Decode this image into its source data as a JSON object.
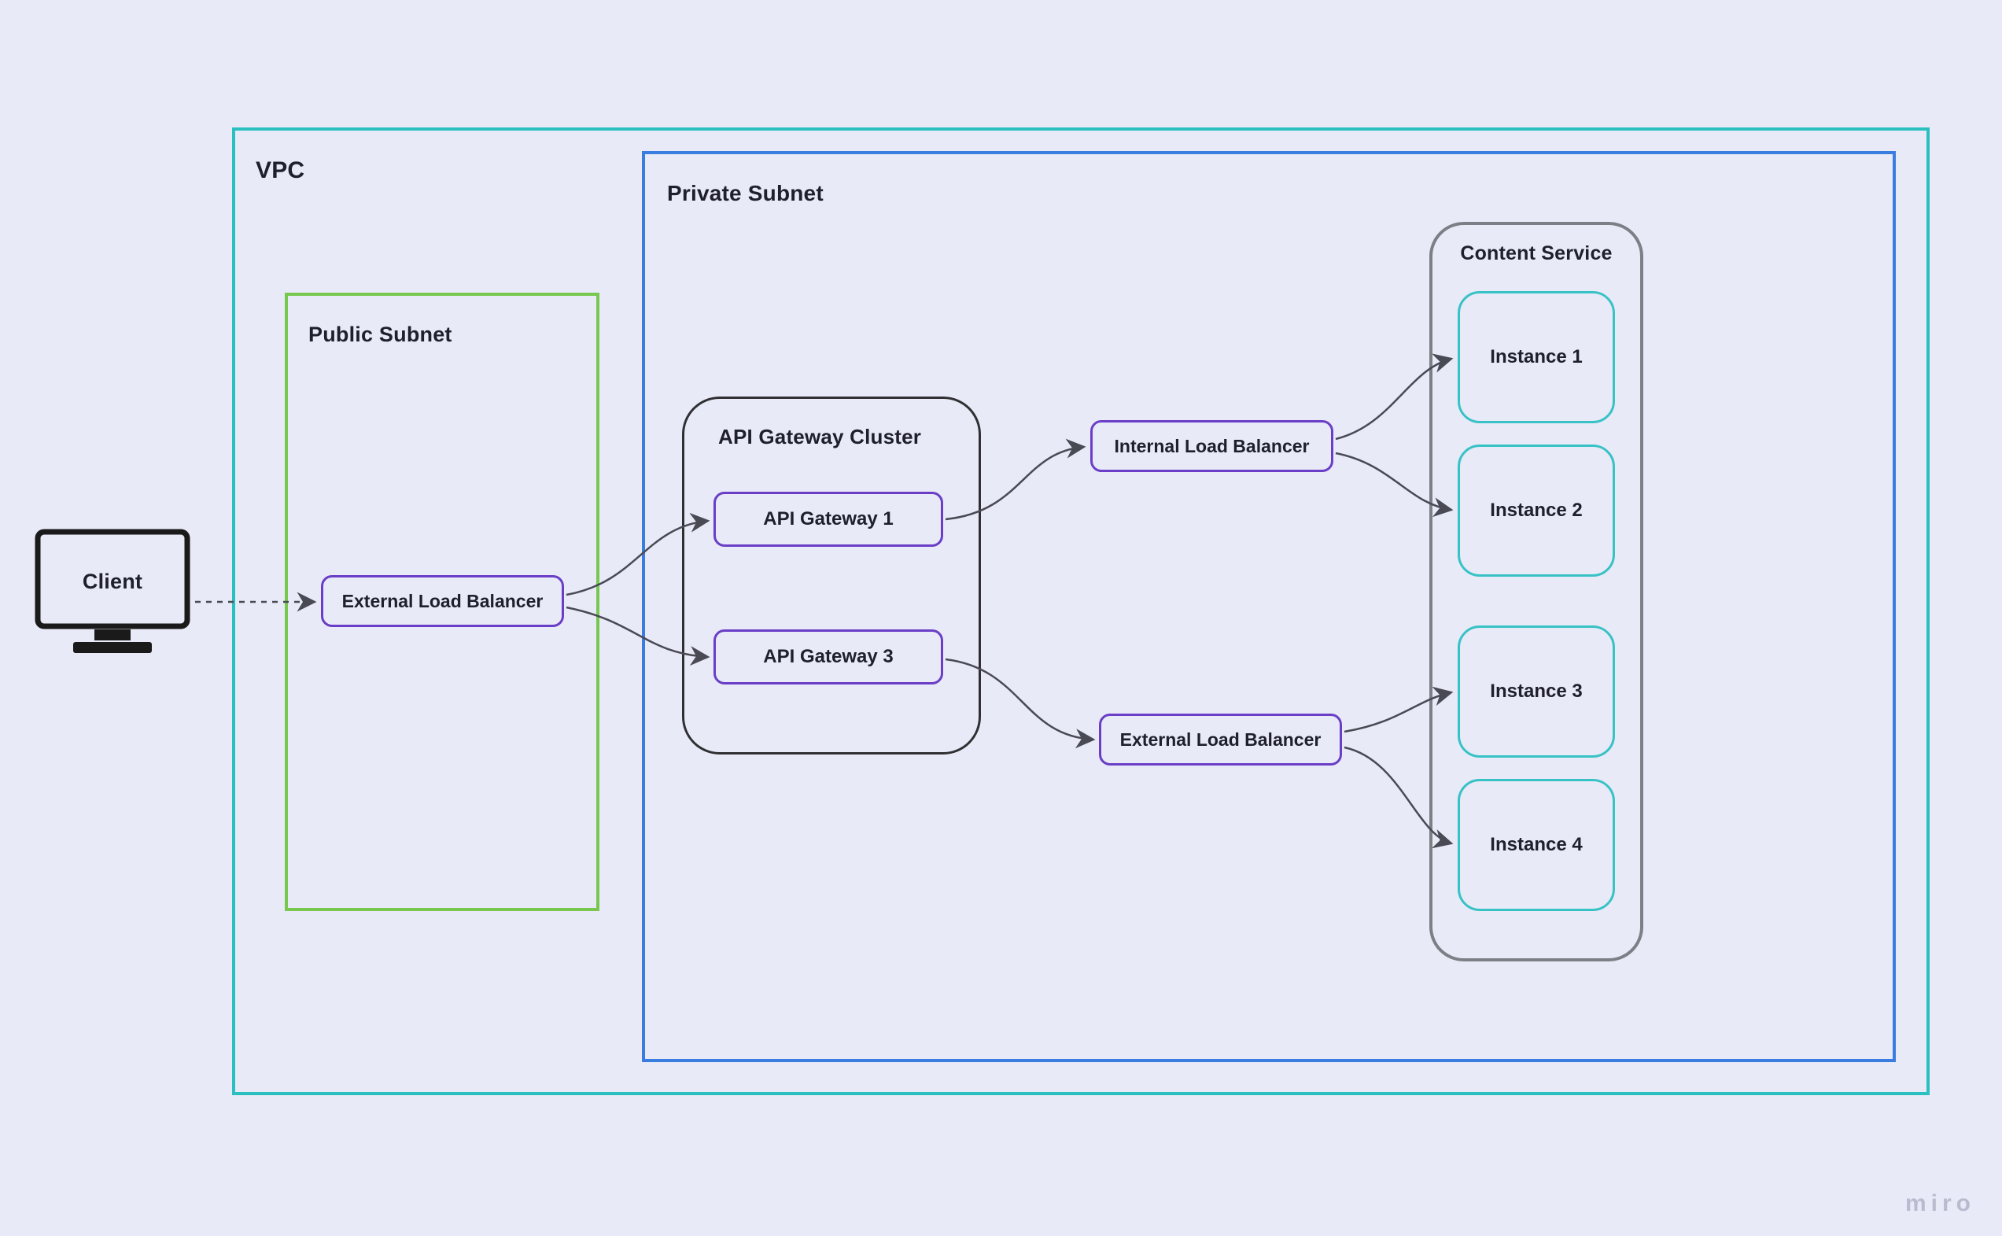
{
  "watermark": "miro",
  "client": {
    "label": "Client"
  },
  "vpc": {
    "label": "VPC"
  },
  "publicSubnet": {
    "label": "Public Subnet",
    "extLB": "External Load Balancer"
  },
  "privateSubnet": {
    "label": "Private Subnet",
    "apiCluster": {
      "label": "API Gateway Cluster",
      "gw1": "API Gateway 1",
      "gw3": "API Gateway 3"
    },
    "internalLB": "Internal Load Balancer",
    "externalLB2": "External Load Balancer",
    "contentService": {
      "label": "Content Service",
      "inst1": "Instance 1",
      "inst2": "Instance 2",
      "inst3": "Instance 3",
      "inst4": "Instance 4"
    }
  },
  "colors": {
    "bg": "#e8eaf7",
    "vpcBorder": "#2bc0c0",
    "publicBorder": "#78c850",
    "privateBorder": "#3a7de0",
    "clusterBorder": "#303033",
    "serviceBorder": "#7e7f86",
    "purpleBorder": "#6a3ec7",
    "instanceBorder": "#37c2c6",
    "arrow": "#4a4a55"
  }
}
